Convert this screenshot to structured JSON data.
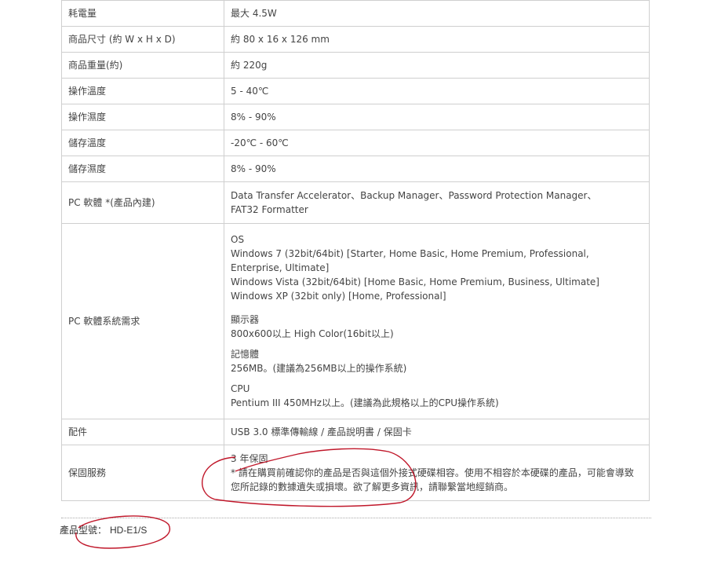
{
  "rows": [
    {
      "label": "耗電量",
      "value": "最大 4.5W"
    },
    {
      "label": "商品尺寸 (約 W x H x D)",
      "value": "約 80 x 16 x 126 mm"
    },
    {
      "label": "商品重量(約)",
      "value": "約 220g"
    },
    {
      "label": "操作溫度",
      "value": "5 - 40℃"
    },
    {
      "label": "操作濕度",
      "value": "8% - 90%"
    },
    {
      "label": "儲存溫度",
      "value": "-20℃ - 60℃"
    },
    {
      "label": "儲存濕度",
      "value": "8% - 90%"
    },
    {
      "label": "PC 軟體 *(產品內建)",
      "value": "Data Transfer Accelerator、Backup Manager、Password Protection Manager、\nFAT32 Formatter"
    },
    {
      "label": "PC 軟體系統需求",
      "os": "OS\nWindows 7 (32bit/64bit) [Starter, Home Basic, Home Premium, Professional,\nEnterprise, Ultimate]\nWindows Vista (32bit/64bit) [Home Basic, Home Premium, Business, Ultimate]\nWindows XP (32bit only) [Home, Professional]",
      "display": "顯示器\n800x600以上 High Color(16bit以上)",
      "memory": "記憶體\n256MB。(建議為256MB以上的操作系統)",
      "cpu": "CPU\nPentium III 450MHz以上。(建議為此規格以上的CPU操作系統)"
    },
    {
      "label": "配件",
      "value": "USB 3.0 標準傳輸線 / 產品說明書 / 保固卡"
    },
    {
      "label": "保固服務",
      "value": "3 年保固\n* 請在購買前確認你的產品是否與這個外接式硬碟相容。使用不相容於本硬碟的產品，可能會導致\n您所記錄的數據遺失或損壞。欲了解更多資訊，請聯繫當地經銷商。"
    }
  ],
  "model": {
    "label": "產品型號：",
    "value": "HD-E1/S"
  },
  "colors": {
    "annotation": "#c0172a",
    "border": "#cfcfcf"
  }
}
